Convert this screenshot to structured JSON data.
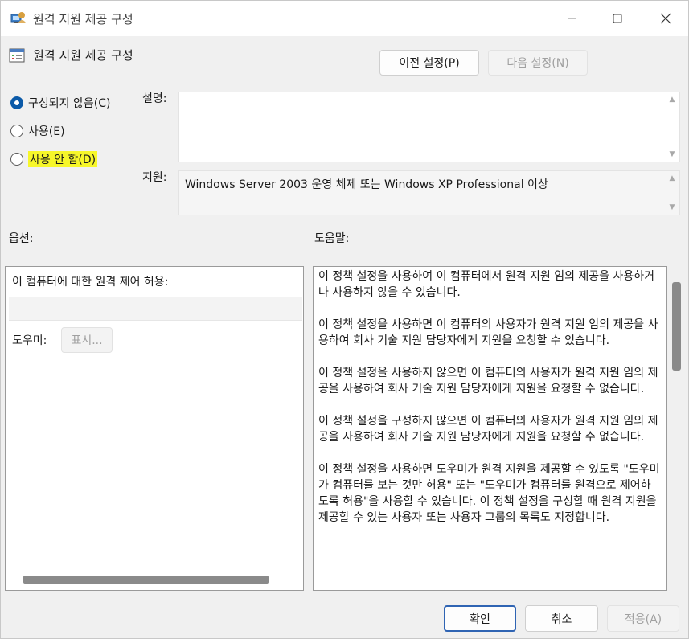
{
  "window": {
    "title": "원격 지원 제공 구성",
    "icons": {
      "app": "policy-settings-icon",
      "minimize": "minimize-icon",
      "maximize": "maximize-icon",
      "close": "close-icon"
    }
  },
  "header": {
    "title": "원격 지원 제공 구성",
    "icon": "policy-settings-icon",
    "prev_label": "이전 설정(P)",
    "next_label": "다음 설정(N)"
  },
  "state": {
    "options": [
      {
        "label": "구성되지 않음(C)",
        "checked": true
      },
      {
        "label": "사용(E)",
        "checked": false
      },
      {
        "label": "사용 안 함(D)",
        "checked": false
      }
    ]
  },
  "details": {
    "description_label": "설명:",
    "description_text": "",
    "supported_label": "지원:",
    "supported_text": "Windows Server 2003 운영 체제 또는 Windows XP Professional 이상"
  },
  "options_section": {
    "label": "옵션:",
    "caption": "이 컴퓨터에 대한 원격 제어 허용:",
    "helper_label": "도우미:",
    "show_label": "표시..."
  },
  "help_section": {
    "label": "도움말:",
    "paragraphs": [
      "이 정책 설정을 사용하여 이 컴퓨터에서 원격 지원 임의 제공을 사용하거나 사용하지 않을 수 있습니다.",
      "이 정책 설정을 사용하면 이 컴퓨터의 사용자가 원격 지원 임의 제공을 사용하여 회사 기술 지원 담당자에게 지원을 요청할 수 있습니다.",
      "이 정책 설정을 사용하지 않으면 이 컴퓨터의 사용자가 원격 지원 임의 제공을 사용하여 회사 기술 지원 담당자에게 지원을 요청할 수 없습니다.",
      "이 정책 설정을 구성하지 않으면 이 컴퓨터의 사용자가 원격 지원 임의 제공을 사용하여 회사 기술 지원 담당자에게 지원을 요청할 수 없습니다.",
      "이 정책 설정을 사용하면 도우미가 원격 지원을 제공할 수 있도록 \"도우미가 컴퓨터를 보는 것만 허용\" 또는 \"도우미가 컴퓨터를 원격으로 제어하도록 허용\"을 사용할 수 있습니다. 이 정책 설정을 구성할 때 원격 지원을 제공할 수 있는 사용자 또는 사용자 그룹의 목록도 지정합니다."
    ]
  },
  "footer": {
    "ok_label": "확인",
    "cancel_label": "취소",
    "apply_label": "적용(A)"
  },
  "colors": {
    "accent": "#0b5aa8",
    "highlight": "#f7f72a"
  }
}
